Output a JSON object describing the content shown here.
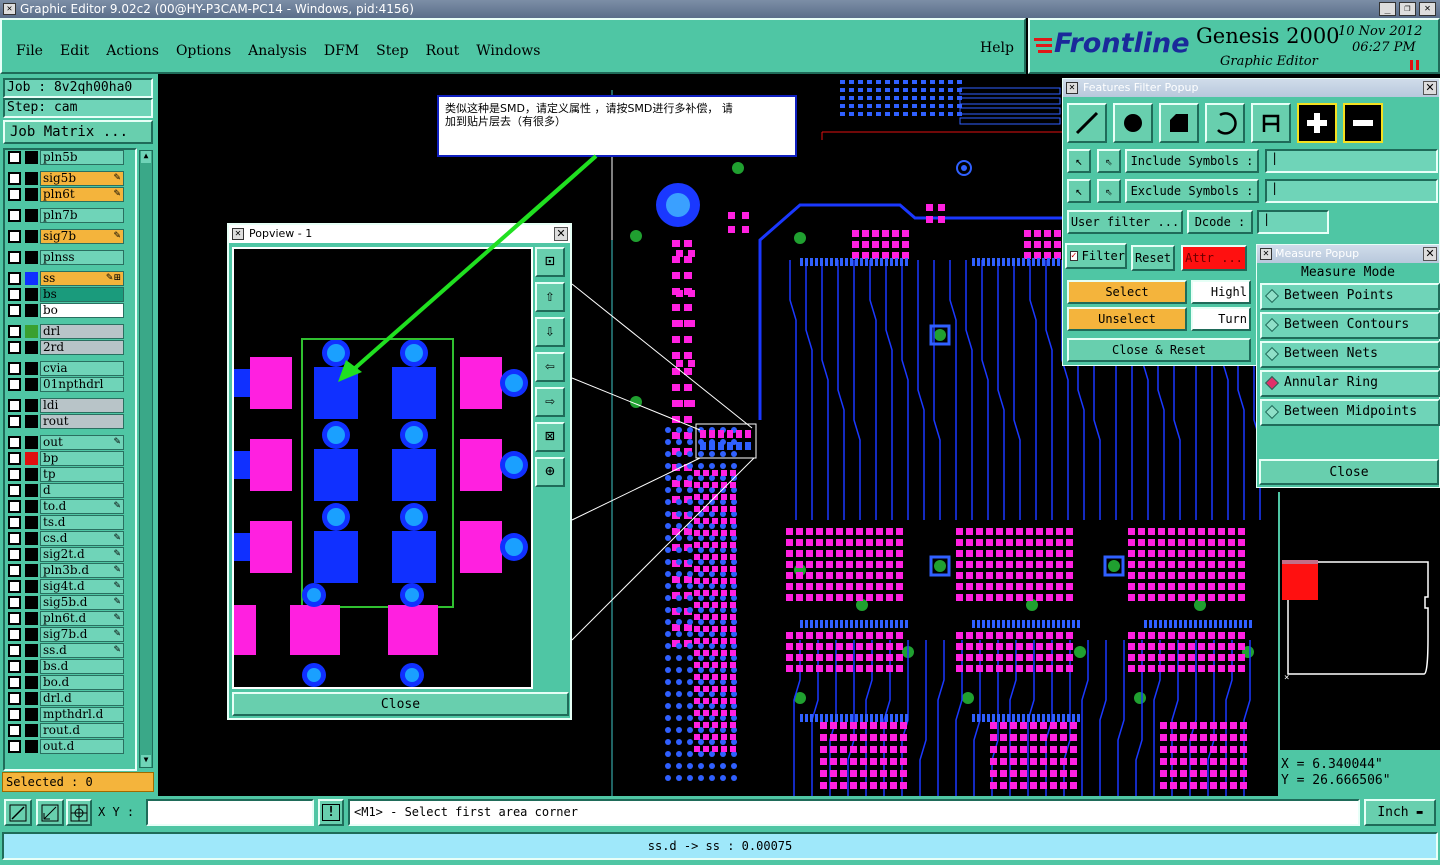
{
  "window": {
    "title": "Graphic Editor 9.02c2 (00@HY-P3CAM-PC14 - Windows, pid:4156)"
  },
  "menu": {
    "items": [
      "File",
      "Edit",
      "Actions",
      "Options",
      "Analysis",
      "DFM",
      "Step",
      "Rout",
      "Windows"
    ],
    "help": "Help"
  },
  "brand": {
    "logo": "Frontline",
    "product": "Genesis 2000",
    "subtitle": "Graphic Editor",
    "date": "10 Nov 2012",
    "time": "06:27 PM"
  },
  "job": {
    "job_label": "Job : 8v2qh00ha0",
    "step_label": "Step: cam",
    "matrix_button": "Job Matrix ..."
  },
  "layers": [
    {
      "name": "pln5b",
      "color": "#6fd4b8",
      "swatch": "#000000",
      "mark": ""
    },
    {
      "name": "sig5b",
      "color": "#f4b43c",
      "swatch": "#000000",
      "mark": "✎"
    },
    {
      "name": "pln6t",
      "color": "#f4b43c",
      "swatch": "#000000",
      "mark": "✎"
    },
    {
      "name": "pln7b",
      "color": "#6fd4b8",
      "swatch": "#000000",
      "mark": ""
    },
    {
      "name": "sig7b",
      "color": "#f4b43c",
      "swatch": "#000000",
      "mark": "✎"
    },
    {
      "name": "plnss",
      "color": "#6fd4b8",
      "swatch": "#000000",
      "mark": ""
    },
    {
      "name": "ss",
      "color": "#f4b43c",
      "swatch": "#1030ff",
      "mark": "✎⊞"
    },
    {
      "name": "bs",
      "color": "#1a9b7c",
      "swatch": "#000000",
      "mark": ""
    },
    {
      "name": "bo",
      "color": "#ffffff",
      "swatch": "#000000",
      "mark": ""
    },
    {
      "name": "drl",
      "color": "#b8c4c8",
      "swatch": "#3aa030",
      "mark": ""
    },
    {
      "name": "2rd",
      "color": "#b8c4c8",
      "swatch": "#000000",
      "mark": ""
    },
    {
      "name": "cvia",
      "color": "#6fd4b8",
      "swatch": "#000000",
      "mark": ""
    },
    {
      "name": "01npthdrl",
      "color": "#6fd4b8",
      "swatch": "#000000",
      "mark": ""
    },
    {
      "name": "ldi",
      "color": "#b8c4c8",
      "swatch": "#000000",
      "mark": ""
    },
    {
      "name": "rout",
      "color": "#b8c4c8",
      "swatch": "#000000",
      "mark": ""
    },
    {
      "name": "out",
      "color": "#6fd4b8",
      "swatch": "#000000",
      "mark": "✎"
    },
    {
      "name": "bp",
      "color": "#6fd4b8",
      "swatch": "#e01010",
      "mark": ""
    },
    {
      "name": "tp",
      "color": "#6fd4b8",
      "swatch": "#000000",
      "mark": ""
    },
    {
      "name": "d",
      "color": "#6fd4b8",
      "swatch": "#000000",
      "mark": ""
    },
    {
      "name": "to.d",
      "color": "#6fd4b8",
      "swatch": "#000000",
      "mark": "✎"
    },
    {
      "name": "ts.d",
      "color": "#6fd4b8",
      "swatch": "#000000",
      "mark": ""
    },
    {
      "name": "cs.d",
      "color": "#6fd4b8",
      "swatch": "#000000",
      "mark": "✎"
    },
    {
      "name": "sig2t.d",
      "color": "#6fd4b8",
      "swatch": "#000000",
      "mark": "✎"
    },
    {
      "name": "pln3b.d",
      "color": "#6fd4b8",
      "swatch": "#000000",
      "mark": "✎"
    },
    {
      "name": "sig4t.d",
      "color": "#6fd4b8",
      "swatch": "#000000",
      "mark": "✎"
    },
    {
      "name": "sig5b.d",
      "color": "#6fd4b8",
      "swatch": "#000000",
      "mark": "✎"
    },
    {
      "name": "pln6t.d",
      "color": "#6fd4b8",
      "swatch": "#000000",
      "mark": "✎"
    },
    {
      "name": "sig7b.d",
      "color": "#6fd4b8",
      "swatch": "#000000",
      "mark": "✎"
    },
    {
      "name": "ss.d",
      "color": "#6fd4b8",
      "swatch": "#000000",
      "mark": "✎"
    },
    {
      "name": "bs.d",
      "color": "#6fd4b8",
      "swatch": "#000000",
      "mark": ""
    },
    {
      "name": "bo.d",
      "color": "#6fd4b8",
      "swatch": "#000000",
      "mark": ""
    },
    {
      "name": "drl.d",
      "color": "#6fd4b8",
      "swatch": "#000000",
      "mark": ""
    },
    {
      "name": "mpthdrl.d",
      "color": "#6fd4b8",
      "swatch": "#000000",
      "mark": ""
    },
    {
      "name": "rout.d",
      "color": "#6fd4b8",
      "swatch": "#000000",
      "mark": ""
    },
    {
      "name": "out.d",
      "color": "#6fd4b8",
      "swatch": "#000000",
      "mark": ""
    }
  ],
  "selected": "Selected : 0",
  "annotation": {
    "line1": "类似这种是SMD，请定义属性  ，请按SMD进行多补偿，  请",
    "line2": "加到贴片层去（有很多）"
  },
  "popview": {
    "title": "Popview - 1",
    "close": "Close"
  },
  "filter_popup": {
    "title": "Features Filter Popup",
    "include_symbols": "Include Symbols :",
    "exclude_symbols": "Exclude Symbols :",
    "user_filter": "User filter ...",
    "dcode": "Dcode :",
    "filter": "Filter",
    "reset": "Reset",
    "attr": "Attr ...",
    "select": "Select",
    "unselect": "Unselect",
    "highlight": "Highl",
    "turn": "Turn",
    "close_reset": "Close & Reset"
  },
  "measure_popup": {
    "title": "Measure Popup",
    "mode_label": "Measure Mode",
    "modes": [
      "Between Points",
      "Between Contours",
      "Between Nets",
      "Annular Ring",
      "Between Midpoints"
    ],
    "active_mode": "Annular Ring",
    "close": "Close"
  },
  "coords": {
    "x": "X = 6.340044\"",
    "y": "Y = 26.666506\""
  },
  "statusbar": {
    "xy_label": "X Y :",
    "xy_value": "",
    "prompt": "<M1> - Select first area corner",
    "units": "Inch",
    "message": "ss.d -> ss : 0.00075"
  },
  "colors": {
    "teal": "#4fc6a4",
    "pad_magenta": "#ff20e0",
    "pad_blue": "#1030ff",
    "trace_blue": "#1a38ff",
    "selected_orange": "#f4b43c",
    "attr_red": "#ff1010"
  }
}
